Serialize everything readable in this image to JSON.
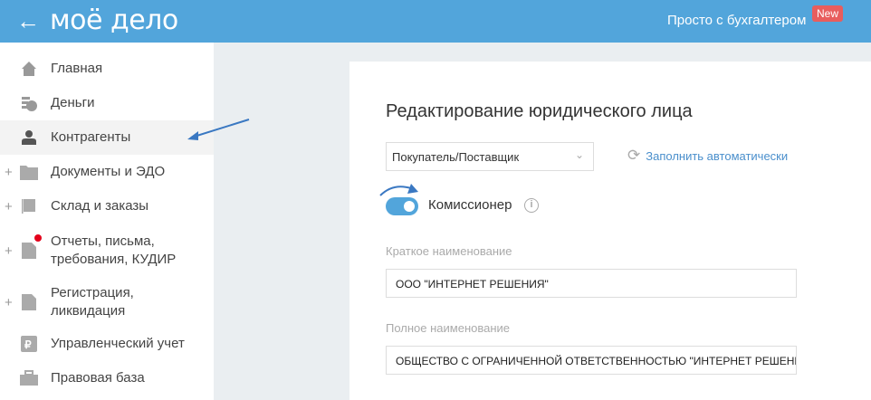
{
  "header": {
    "back_icon": "arrow-left-icon",
    "logo": "моё дело",
    "promo": "Просто с бухгалтером",
    "badge": "New"
  },
  "sidebar": {
    "items": [
      {
        "label": "Главная",
        "icon": "home-icon"
      },
      {
        "label": "Деньги",
        "icon": "money-icon"
      },
      {
        "label": "Контрагенты",
        "icon": "person-icon",
        "active": true
      },
      {
        "label": "Документы и ЭДО",
        "icon": "folder-icon",
        "expandable": true
      },
      {
        "label": "Склад и заказы",
        "icon": "warehouse-icon",
        "expandable": true
      },
      {
        "label": "Отчеты, письма, требования, КУДИР",
        "icon": "report-icon",
        "expandable": true,
        "notification": true
      },
      {
        "label": "Регистрация, ликвидация",
        "icon": "registration-icon",
        "expandable": true
      },
      {
        "label": "Управленческий учет",
        "icon": "ruble-icon"
      },
      {
        "label": "Правовая база",
        "icon": "briefcase-icon"
      }
    ],
    "plus": "+"
  },
  "form": {
    "title": "Редактирование юридического лица",
    "type_select": "Покупатель/Поставщик",
    "autofill": "Заполнить автоматически",
    "commissioner_label": "Комиссионер",
    "commissioner_on": true,
    "short_name_label": "Краткое наименование",
    "short_name_value": "ООО \"ИНТЕРНЕТ РЕШЕНИЯ\"",
    "full_name_label": "Полное наименование",
    "full_name_value": "ОБЩЕСТВО С ОГРАНИЧЕННОЙ ОТВЕТСТВЕННОСТЬЮ \"ИНТЕРНЕТ РЕШЕНИЯ\""
  },
  "colors": {
    "header": "#52a5db",
    "accent": "#4a8fcc",
    "badge": "#e85d5d"
  }
}
